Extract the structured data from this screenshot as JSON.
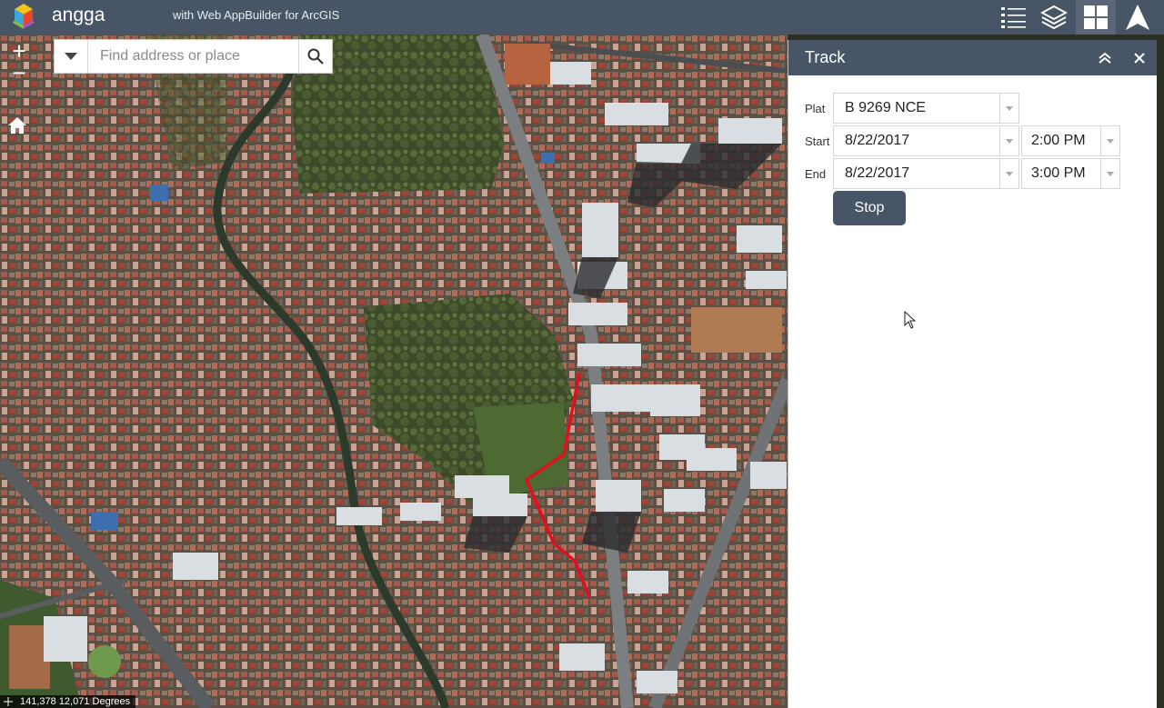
{
  "header": {
    "app_title": "angga",
    "app_subtitle": "with Web AppBuilder for ArcGIS",
    "accent_color": "#485566"
  },
  "toolbar": {
    "buttons": [
      {
        "icon": "legend-list-icon"
      },
      {
        "icon": "layers-icon"
      },
      {
        "icon": "widget-grid-icon"
      },
      {
        "icon": "north-arrow-icon"
      }
    ]
  },
  "map": {
    "zoom_in": "+",
    "zoom_out": "−",
    "search": {
      "placeholder": "Find address or place",
      "value": ""
    },
    "coordinates": "141,378 12,071 Degrees",
    "route_color": "#e0101c"
  },
  "panel": {
    "title": "Track",
    "plat_label": "Plat",
    "plat_value": "B 9269 NCE",
    "start_label": "Start",
    "start_date": "8/22/2017",
    "start_time": "2:00 PM",
    "end_label": "End",
    "end_date": "8/22/2017",
    "end_time": "3:00 PM",
    "stop_label": "Stop"
  }
}
